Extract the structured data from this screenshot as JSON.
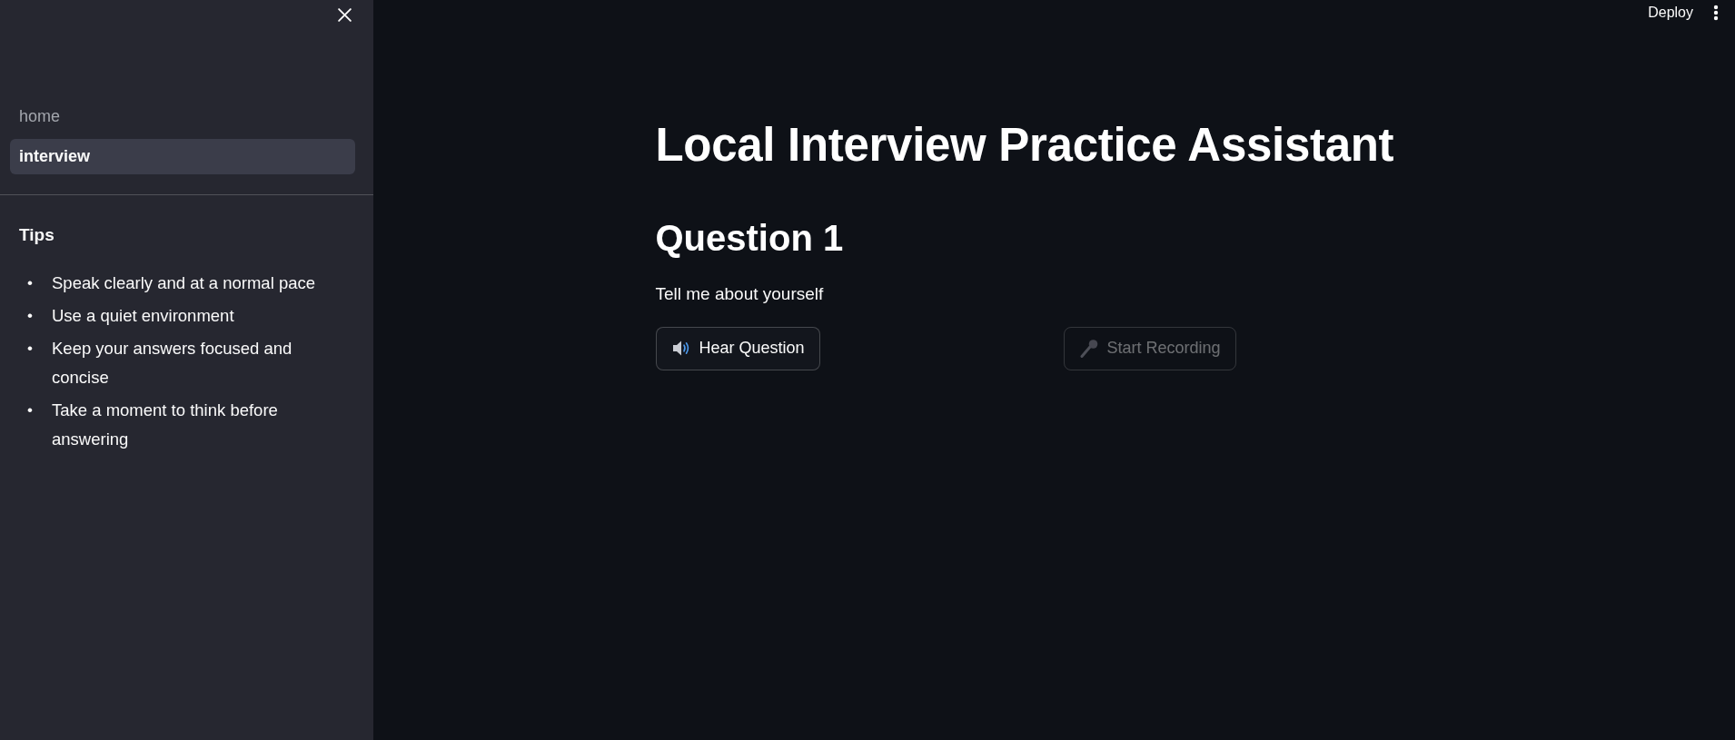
{
  "sidebar": {
    "nav": [
      {
        "label": "home",
        "selected": false
      },
      {
        "label": "interview",
        "selected": true
      }
    ],
    "tips": {
      "title": "Tips",
      "items": [
        {
          "bullet": "•",
          "text": "Speak clearly and at a normal pace"
        },
        {
          "bullet": "•",
          "text": "Use a quiet environment"
        },
        {
          "bullet": "•",
          "text": "Keep your answers focused and concise"
        },
        {
          "bullet": "•",
          "text": "Take a moment to think before answering"
        }
      ]
    }
  },
  "toolbar": {
    "deploy": "Deploy"
  },
  "main": {
    "title": "Local Interview Practice Assistant",
    "question_heading": "Question 1",
    "question_text": "Tell me about yourself",
    "buttons": [
      {
        "label": "Hear Question",
        "disabled": false
      },
      {
        "label": "Start Recording",
        "disabled": true
      }
    ]
  }
}
